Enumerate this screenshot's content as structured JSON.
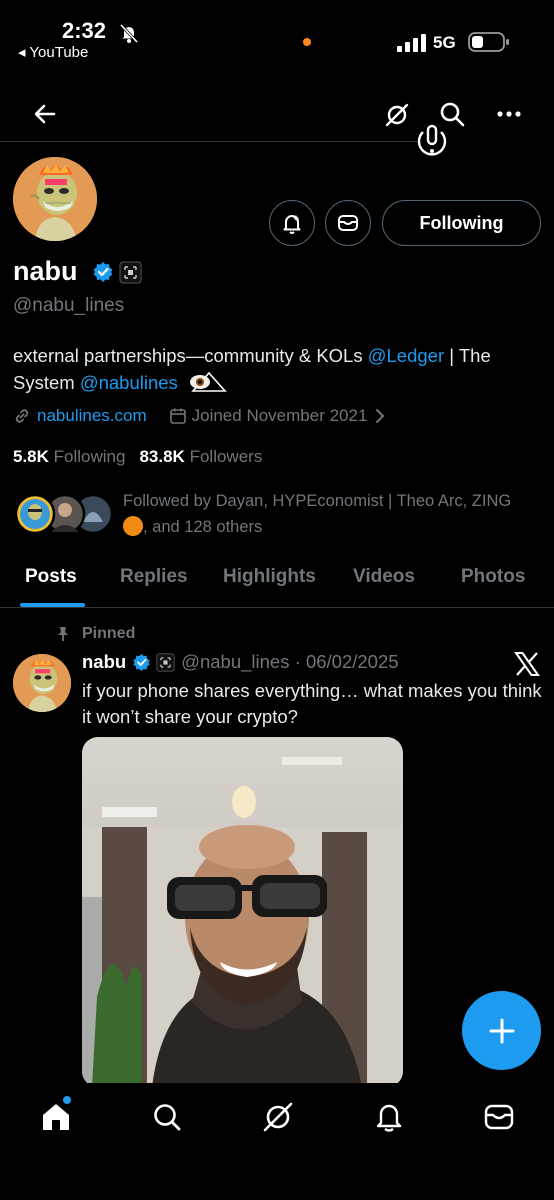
{
  "status_bar": {
    "time": "2:32",
    "back_app": "◂ YouTube",
    "network": "5G"
  },
  "profile": {
    "name": "nabu",
    "handle": "@nabu_lines",
    "bio_text": "external partnerships—community & KOLs ",
    "bio_mention_1": "@Ledger",
    "bio_mid": " | The System ",
    "bio_mention_2": "@nabulines",
    "website": "nabulines.com",
    "joined": "Joined November 2021",
    "following_count": "5.8K",
    "following_label": "Following",
    "followers_count": "83.8K",
    "followers_label": "Followers",
    "followed_by_text": "Followed by Dayan, HYPEconomist | Theo Arc, ZING",
    "followed_by_suffix": ", and 128 others",
    "follow_button": "Following"
  },
  "tabs": [
    "Posts",
    "Replies",
    "Highlights",
    "Videos",
    "Photos"
  ],
  "pinned_post": {
    "pinned_label": "Pinned",
    "author_name": "nabu",
    "author_handle": "@nabu_lines",
    "date": "06/02/2025",
    "text": "if your phone shares everything… what makes you think it won’t share your crypto?"
  },
  "colors": {
    "accent": "#1d9bf0",
    "background": "#000000",
    "muted_text": "#71767b"
  },
  "icons": [
    "back-arrow-icon",
    "grok-icon",
    "search-icon",
    "more-icon",
    "notification-bell-icon",
    "message-icon",
    "verified-badge-icon",
    "link-icon",
    "calendar-icon",
    "pin-icon",
    "x-logo-icon",
    "compose-plus-icon",
    "home-icon",
    "explore-icon",
    "grok-nav-icon",
    "notifications-icon",
    "messages-icon"
  ]
}
